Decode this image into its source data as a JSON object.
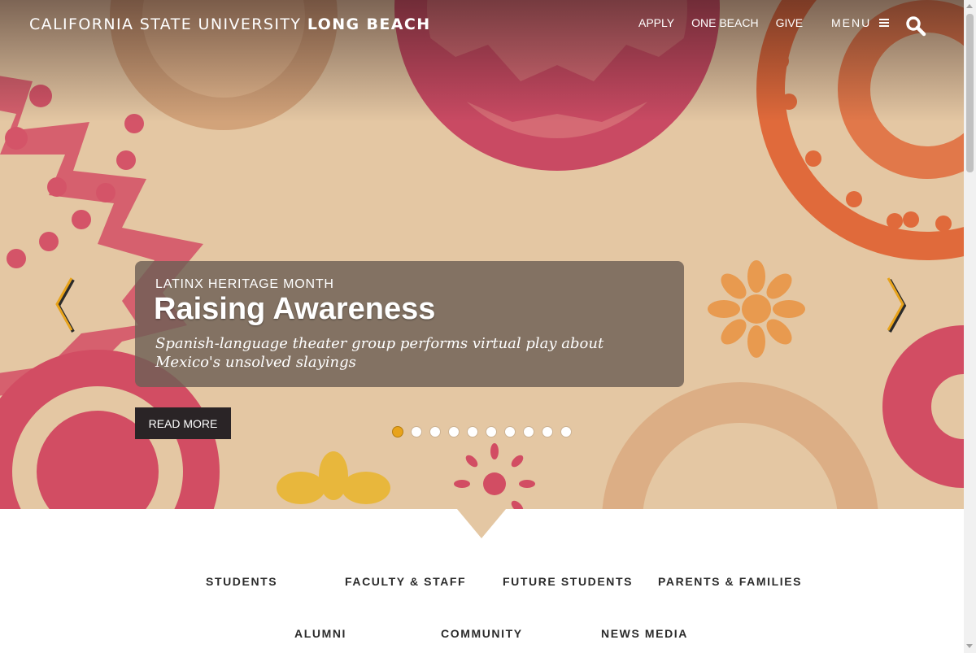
{
  "header": {
    "brand_thin": "CALIFORNIA STATE UNIVERSITY",
    "brand_bold": "LONG BEACH",
    "nav": [
      "APPLY",
      "ONE BEACH",
      "GIVE"
    ],
    "menu_label": "MENU",
    "search_icon": "search-icon"
  },
  "hero": {
    "kicker": "LATINX HERITAGE MONTH",
    "headline": "Raising Awareness",
    "dek": "Spanish-language theater group performs virtual play about Mexico's unsolved slayings",
    "read_more": "READ MORE",
    "slide_count": 10,
    "active_slide": 1,
    "colors": {
      "accent": "#e8a31b",
      "background": "#e4c7a3",
      "pink": "#d24d63",
      "orange": "#e06a3b",
      "yellow": "#e8b73c"
    }
  },
  "audience_links": {
    "students": "STUDENTS",
    "faculty": "FACULTY & STAFF",
    "future": "FUTURE STUDENTS",
    "parents": "PARENTS & FAMILIES",
    "alumni": "ALUMNI",
    "community": "COMMUNITY",
    "media": "NEWS MEDIA"
  }
}
